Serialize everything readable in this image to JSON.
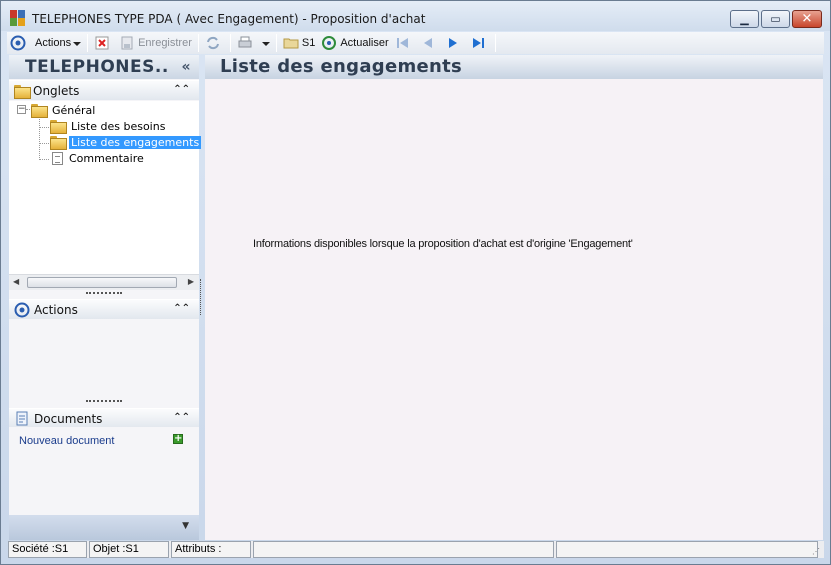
{
  "window": {
    "title": "TELEPHONES TYPE PDA ( Avec Engagement) -  Proposition d'achat",
    "minimize_glyph": "▁",
    "maximize_glyph": "▭",
    "close_glyph": "✕"
  },
  "toolbar": {
    "actions_label": "Actions",
    "save_label": "Enregistrer",
    "company_code": "S1",
    "refresh_label": "Actualiser"
  },
  "sidebar": {
    "title": "TELEPHONES..",
    "collapse_glyph": "«",
    "onglets_header": "Onglets",
    "tree": {
      "root": "Général",
      "items": [
        {
          "label": "Liste des besoins"
        },
        {
          "label": "Liste des engagements"
        },
        {
          "label": "Commentaire"
        }
      ]
    },
    "actions_header": "Actions",
    "documents_header": "Documents",
    "new_document_label": "Nouveau document"
  },
  "main": {
    "title": "Liste des engagements",
    "info_text": "Informations disponibles lorsque la proposition d'achat est d'origine 'Engagement'"
  },
  "statusbar": {
    "societe": "Société :S1",
    "objet": "Objet :S1",
    "attributs": "Attributs :"
  },
  "colors": {
    "accent": "#3399ff",
    "panel_header": "#2f3e52",
    "link": "#1a3c8c"
  }
}
